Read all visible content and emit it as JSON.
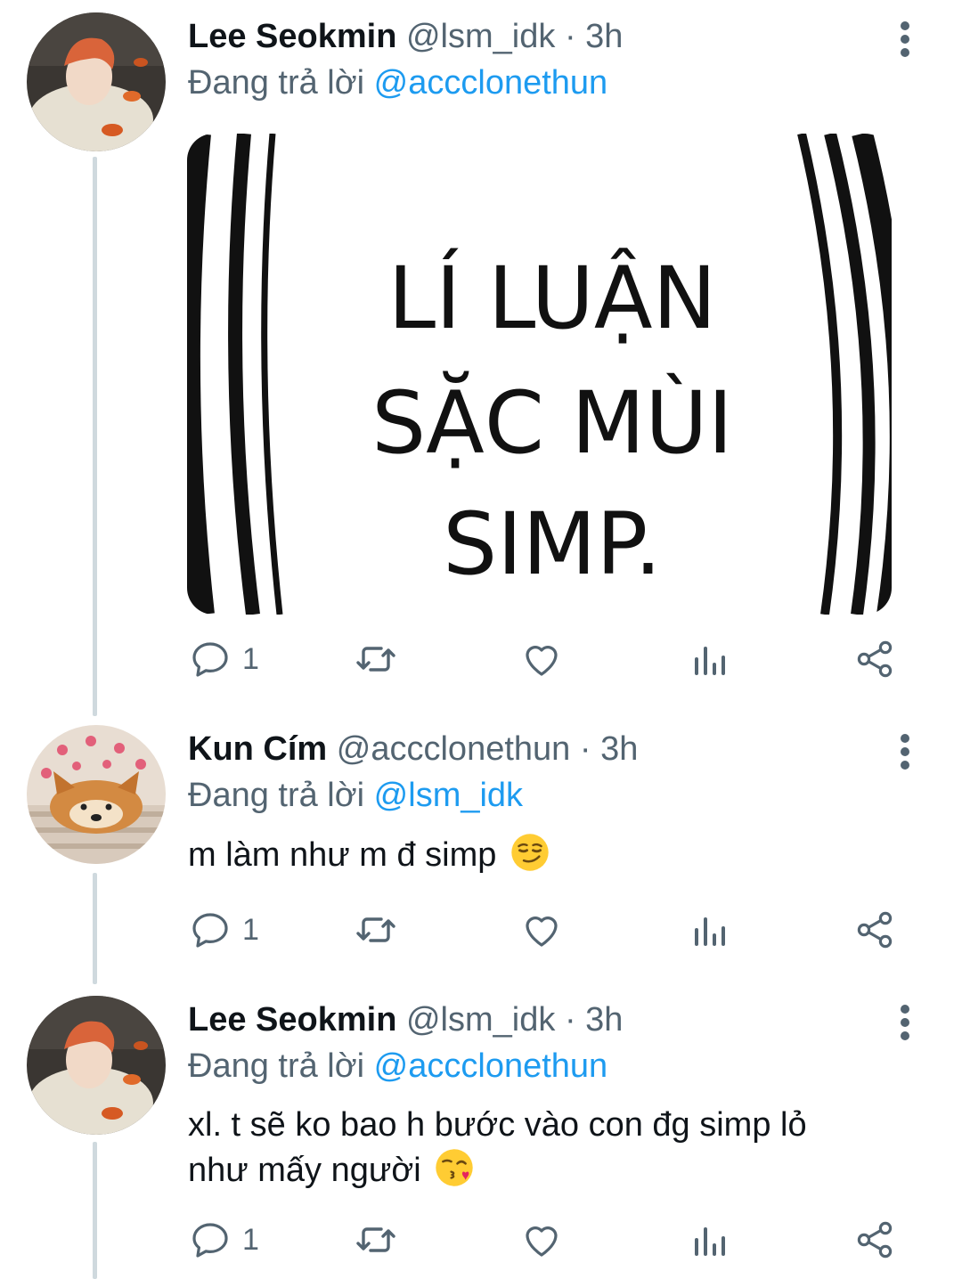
{
  "tweets": [
    {
      "name": "Lee Seokmin",
      "handle": "@lsm_idk",
      "dot": "·",
      "time": "3h",
      "replying_label": "Đang trả lời",
      "replying_to": "@accclonethun",
      "media_text": [
        "LÍ LUẬN",
        "SẶC MÙI",
        "SIMP."
      ],
      "reply_count": "1"
    },
    {
      "name": "Kun Cím",
      "handle": "@accclonethun",
      "dot": "·",
      "time": "3h",
      "replying_label": "Đang trả lời",
      "replying_to": "@lsm_idk",
      "text": "m làm như m đ simp",
      "emoji": "smirking-face",
      "reply_count": "1"
    },
    {
      "name": "Lee Seokmin",
      "handle": "@lsm_idk",
      "dot": "·",
      "time": "3h",
      "replying_label": "Đang trả lời",
      "replying_to": "@accclonethun",
      "text_line1": "xl. t sẽ ko bao h bước vào con đg simp lỏ",
      "text_line2": "như mấy người",
      "emoji": "face-blowing-a-kiss",
      "reply_count": "1"
    }
  ],
  "colors": {
    "text": "#0f1419",
    "secondary": "#536471",
    "link": "#1d9bf0",
    "thread_line": "#cfd9de"
  },
  "icons": [
    "reply-icon",
    "retweet-icon",
    "like-icon",
    "analytics-icon",
    "share-icon",
    "more-icon"
  ]
}
